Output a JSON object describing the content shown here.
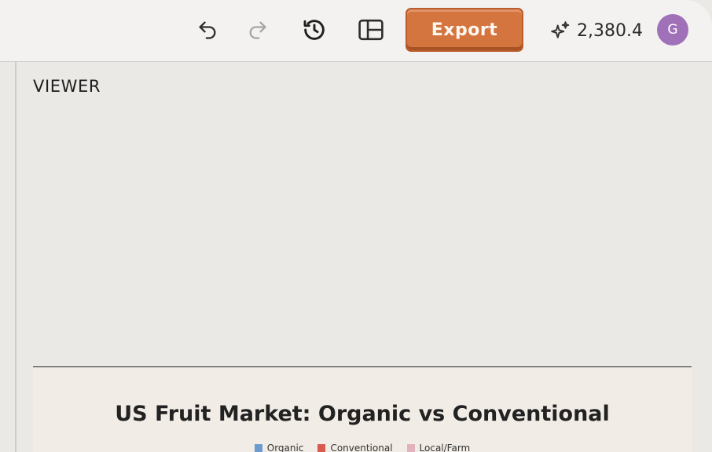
{
  "toolbar": {
    "undo_icon": "undo-icon",
    "redo_icon": "redo-icon",
    "history_icon": "history-icon",
    "layout_icon": "panel-layout-icon",
    "export_label": "Export",
    "credits_icon": "sparkles-icon",
    "credits_value": "2,380.4",
    "avatar_initial": "G"
  },
  "viewer": {
    "label": "VIEWER"
  },
  "chart": {
    "title": "US Fruit Market: Organic vs Conventional",
    "legend": [
      {
        "label": "Organic",
        "color": "#6e9bcf"
      },
      {
        "label": "Conventional",
        "color": "#d95b4f"
      },
      {
        "label": "Local/Farm",
        "color": "#e2b3be"
      }
    ]
  },
  "colors": {
    "accent": "#d4753f",
    "avatar": "#a071b9",
    "background": "#ebe9e5"
  }
}
